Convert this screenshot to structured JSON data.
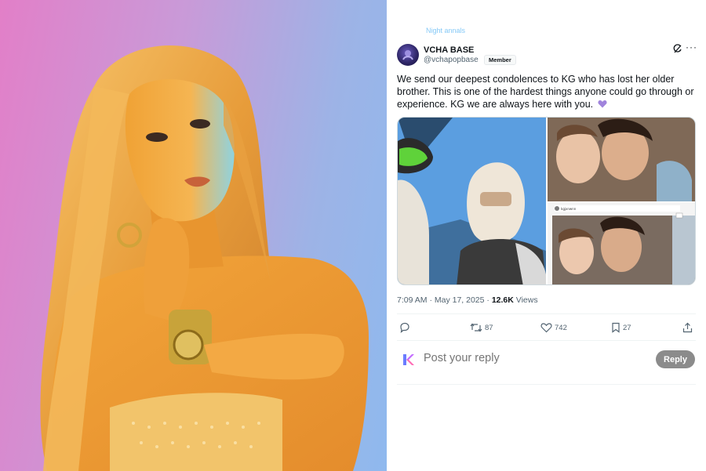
{
  "photo": {
    "description_icon": "woman-portrait-photo"
  },
  "tweet": {
    "top_cut_text": "Night annals",
    "author": {
      "name": "VCHA BASE",
      "handle": "@vchapopbase",
      "badge": "Member"
    },
    "text": "We send our deepest condolences to KG who has lost her older brother. This is one of the hardest things anyone could go through or experience. KG we are always here with you.",
    "emoji": "purple-heart",
    "media_caption_user": "kgjxnwnn",
    "timestamp": "7:09 AM · May 17, 2025 · ",
    "views_count": "12.6K",
    "views_label": " Views",
    "actions": {
      "reply_count": "",
      "retweet_count": "87",
      "like_count": "742",
      "bookmark_count": "27"
    },
    "reply": {
      "placeholder": "Post your reply",
      "button_label": "Reply"
    }
  },
  "colors": {
    "accent": "#1d9bf0",
    "text_primary": "#0f1419",
    "text_secondary": "#536471",
    "reply_button": "#8b8b8b",
    "emoji_heart": "#a084dc"
  }
}
